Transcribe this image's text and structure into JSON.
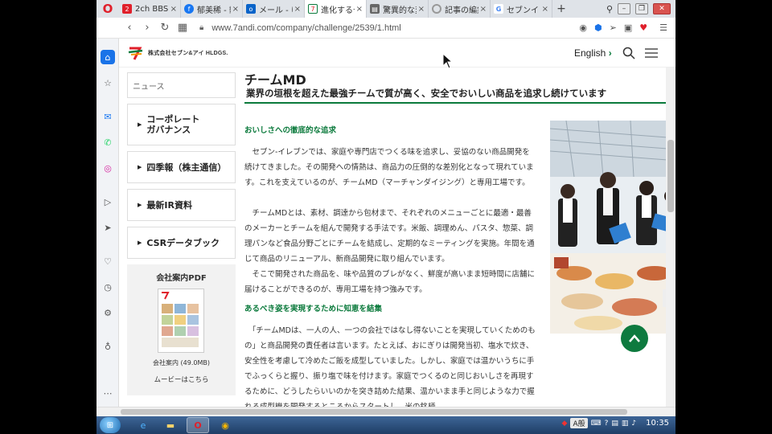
{
  "browser": {
    "tabs": [
      {
        "label": "2ch BBS",
        "favicon": "2ch-icon",
        "color": "#e0202b",
        "active": false
      },
      {
        "label": "郁美稀 - 動",
        "favicon": "facebook-icon",
        "color": "#1877f2",
        "active": false
      },
      {
        "label": "メール - ゆ",
        "favicon": "outlook-icon",
        "color": "#0a64c9",
        "active": false
      },
      {
        "label": "進化するセ",
        "favicon": "seven-icon",
        "color": "#0b7a3c",
        "active": true
      },
      {
        "label": "驚異的な変",
        "favicon": "page-icon",
        "color": "#555555",
        "active": false
      },
      {
        "label": "記事の編集",
        "favicon": "loading-icon",
        "color": "#888888",
        "active": false
      },
      {
        "label": "セブンイレ",
        "favicon": "google-icon",
        "color": "#4285f4",
        "active": false
      }
    ],
    "url": "www.7andi.com/company/challenge/2539/1.html"
  },
  "site": {
    "logo_text": "株式会社セブン&アイ HLDGS.",
    "english_label": "English"
  },
  "leftnav": {
    "news": "ニュース",
    "items": [
      {
        "label": "コーポレート\nガバナンス"
      },
      {
        "label": "四季報（株主通信）"
      },
      {
        "label": "最新IR資料"
      },
      {
        "label": "CSRデータブック"
      }
    ],
    "pdf_title": "会社案内PDF",
    "pdf_caption": "会社案内 (49.0MB)",
    "pdf_movie": "ムービーはこちら"
  },
  "main": {
    "title": "チームMD",
    "subtitle": "業界の垣根を超えた最強チームで質が高く、安全でおいしい商品を追求し続けています",
    "section1_heading": "おいしさへの徹底的な追求",
    "para1": "　セブン-イレブンでは、家庭や専門店でつくる味を追求し、妥協のない商品開発を続けてきました。その開発への情熱は、商品力の圧倒的な差別化となって現れています。これを支えているのが、チームMD（マーチャンダイジング）と専用工場です。",
    "para2": "　チームMDとは、素材、調達から包材まで、それぞれのメニューごとに最適・最善のメーカーとチームを組んで開発する手法です。米飯、調理めん、パスタ、惣菜、調理パンなど食品分野ごとにチームを結成し、定期的なミーティングを実施。年間を通じて商品のリニューアル、新商品開発に取り組んでいます。",
    "para3": "　そこで開発された商品を、味や品質のブレがなく、鮮度が高いまま短時間に店舗に届けることができるのが、専用工場を持つ強みです。",
    "section2_heading": "あるべき姿を実現するために知恵を結集",
    "para4": "　「チームMDは、一人の人、一つの会社ではなし得ないことを実現していくためのもの」と商品開発の責任者は言います。たとえば、おにぎりは開発当初、塩水で炊き、安全性を考慮して冷めたご飯を成型していました。しかし、家庭では温かいうちに手でふっくらと握り、振り塩で味を付けます。家庭でつくるのと同じおいしさを再現するために、どうしたらいいのかを突き詰めた結果、温かいまま手と同じような力で握れる成型機を開発するところからスタートし、米の銘柄、"
  },
  "taskbar": {
    "ime": "A般",
    "time": "10:35"
  }
}
